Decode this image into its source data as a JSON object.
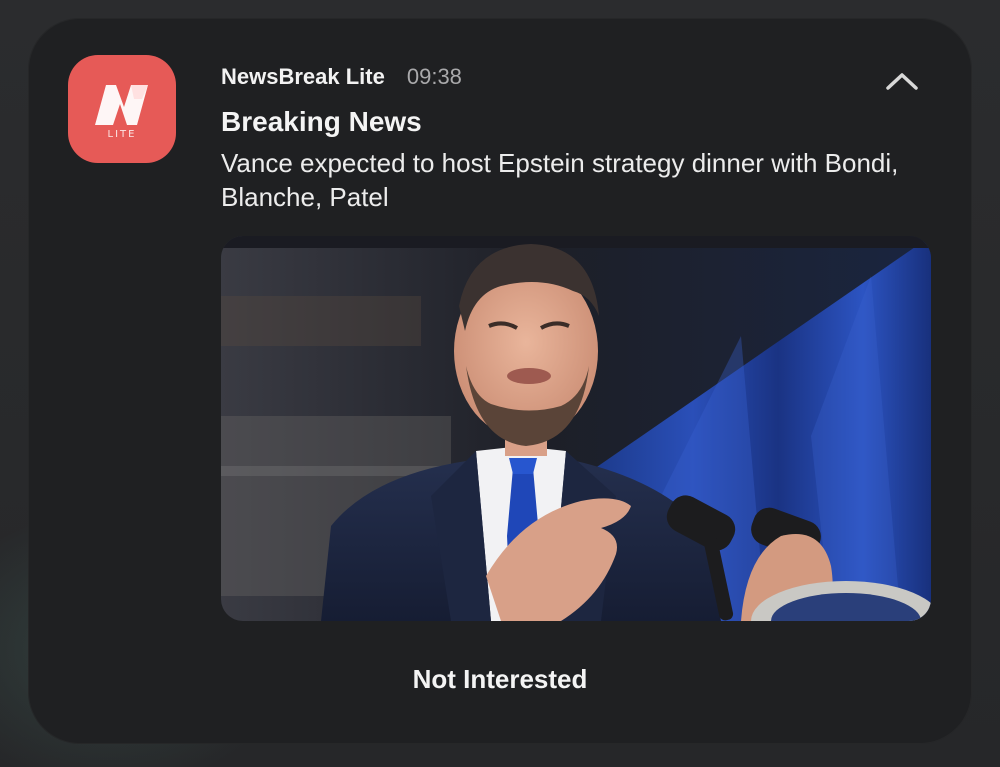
{
  "notification": {
    "app_name": "NewsBreak Lite",
    "time": "09:38",
    "title": "Breaking News",
    "body": "Vance expected to host Epstein strategy dinner with Bondi, Blanche, Patel",
    "action_label": "Not Interested",
    "icon": {
      "name": "newsbreak-lite-logo",
      "badge_text": "LITE",
      "color": "#e65a57"
    },
    "collapse_icon": "chevron-up-icon",
    "image": {
      "subject": "news-photo"
    }
  },
  "colors": {
    "card_background": "#1f2022",
    "page_background": "#2a2b2d",
    "accent": "#e65a57",
    "text_primary": "#f2f2f2",
    "text_secondary": "#a9a9ab"
  }
}
